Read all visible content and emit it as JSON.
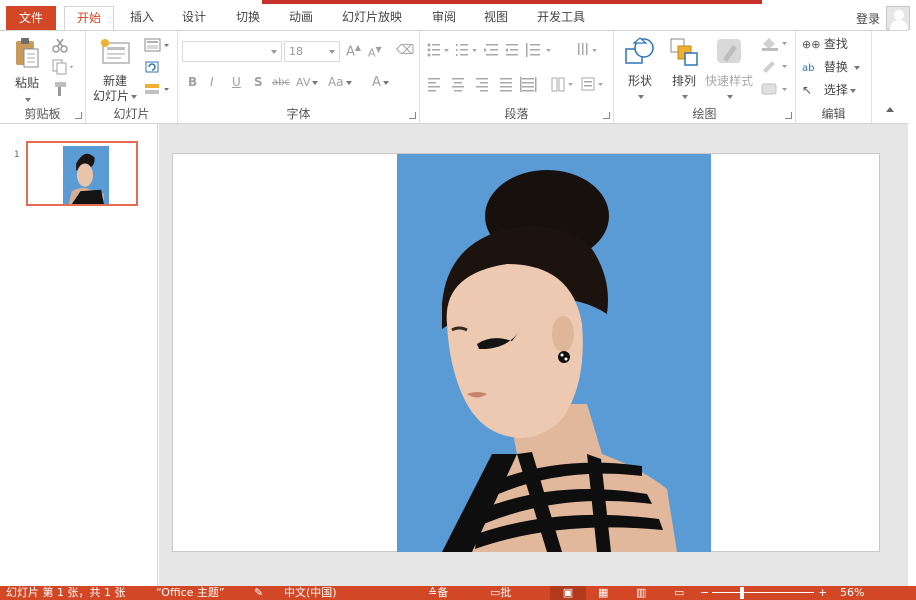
{
  "tabs": {
    "file": "文件",
    "home": "开始",
    "insert": "插入",
    "design": "设计",
    "transitions": "切换",
    "animations": "动画",
    "slideshow": "幻灯片放映",
    "review": "审阅",
    "view": "视图",
    "developer": "开发工具"
  },
  "account": {
    "login": "登录"
  },
  "ribbon": {
    "clipboard": {
      "label": "剪贴板",
      "paste": "粘贴"
    },
    "slides": {
      "label": "幻灯片",
      "new_slide_line1": "新建",
      "new_slide_line2": "幻灯片"
    },
    "font": {
      "label": "字体",
      "font_name": "",
      "font_size": "18",
      "bold": "B",
      "italic": "I",
      "underline": "U",
      "shadow": "S",
      "strike": "abc",
      "spacing": "AV",
      "case": "Aa",
      "color": "A"
    },
    "paragraph": {
      "label": "段落"
    },
    "drawing": {
      "label": "绘图",
      "shapes": "形状",
      "arrange": "排列",
      "quick_styles": "快速样式"
    },
    "editing": {
      "label": "编辑",
      "find": "查找",
      "replace": "替换",
      "select": "选择"
    }
  },
  "thumbnails": {
    "slide_number": "1"
  },
  "status": {
    "slide_info": "幻灯片 第 1 张，共 1 张",
    "theme": "“Office 主题”",
    "language": "中文(中国)",
    "notes": "备注",
    "comments": "批注",
    "zoom": "56%"
  },
  "colors": {
    "accent": "#d24726",
    "photo_background": "#5b9bd5",
    "thumb_border": "#e46c53"
  }
}
